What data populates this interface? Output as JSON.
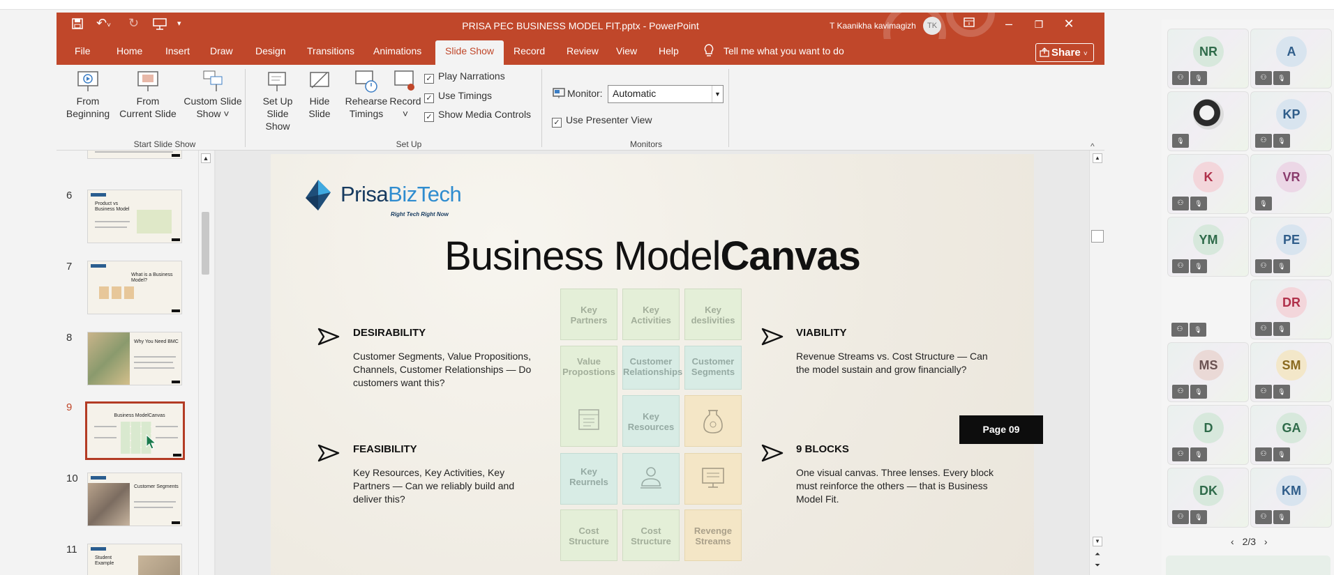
{
  "window": {
    "doc_title": "PRISA PEC BUSINESS MODEL FIT.pptx  -  PowerPoint",
    "user_name": "T Kaanikha kavimagizh",
    "user_initials": "TK",
    "accent": "#c0472a"
  },
  "tabs": [
    "File",
    "Home",
    "Insert",
    "Draw",
    "Design",
    "Transitions",
    "Animations",
    "Slide Show",
    "Record",
    "Review",
    "View",
    "Help"
  ],
  "active_tab": "Slide Show",
  "tell_me": "Tell me what you want to do",
  "share_label": "Share",
  "ribbon": {
    "from_beginning": [
      "From",
      "Beginning"
    ],
    "from_current": [
      "From",
      "Current Slide"
    ],
    "custom_show": [
      "Custom Slide",
      "Show ˅"
    ],
    "group_start": "Start Slide Show",
    "setup_show": [
      "Set Up",
      "Slide Show"
    ],
    "hide_slide": [
      "Hide",
      "Slide"
    ],
    "rehearse": [
      "Rehearse",
      "Timings"
    ],
    "record": [
      "Record",
      "˅"
    ],
    "play_narrations": "Play Narrations",
    "use_timings": "Use Timings",
    "show_media_controls": "Show Media Controls",
    "group_setup": "Set Up",
    "monitor_label": "Monitor:",
    "monitor_value": "Automatic",
    "use_presenter_view": "Use Presenter View",
    "group_monitors": "Monitors"
  },
  "thumbnails": [
    {
      "num": "6",
      "title": "Product vs Business Model"
    },
    {
      "num": "7",
      "title": "What is a Business Model?"
    },
    {
      "num": "8",
      "title": "Why You Need BMC"
    },
    {
      "num": "9",
      "title": "Business ModelCanvas",
      "selected": true
    },
    {
      "num": "10",
      "title": "Customer Segments"
    },
    {
      "num": "11",
      "title": "Student Example"
    }
  ],
  "slide": {
    "logo_a": "Prisa",
    "logo_b": "BizTech",
    "logo_tag": "Right Tech Right Now",
    "title_regular": "Business Model",
    "title_bold": "Canvas",
    "desirability": {
      "head": "DESIRABILITY",
      "body": "Customer Segments, Value Propositions, Channels, Customer Relationships — Do customers want this?"
    },
    "feasibility": {
      "head": "FEASIBILITY",
      "body": "Key Resources, Key Activities, Key Partners — Can we reliably build and deliver this?"
    },
    "viability": {
      "head": "VIABILITY",
      "body": "Revenue Streams vs. Cost Structure — Can the model sustain and grow financially?"
    },
    "nine_blocks": {
      "head": "9 BLOCKS",
      "body": "One visual canvas. Three lenses. Every block must reinforce the others — that is Business Model Fit."
    },
    "cells": {
      "key_partners": "Key Partners",
      "key_activities": "Key Activities",
      "key_deslivities": "Key deslivities",
      "value_propostions": "Value Propostions",
      "customer_relationships": "Customer Relationships",
      "customer_segments": "Customer Segments",
      "key_resources": "Key Resources",
      "key_reurnels": "Key Reurnels",
      "cost_structure_1": "Cost Structure",
      "cost_structure_2": "Cost Structure",
      "revenge_streams": "Revenge Streams"
    },
    "page_tag": "Page 09"
  },
  "participants": [
    {
      "initials": "NR",
      "color": "#2f6b4a",
      "bg": "#d7e8dc"
    },
    {
      "initials": "A",
      "color": "#2f5d8a",
      "bg": "#d8e4ef"
    },
    {
      "initials": "",
      "photo": true
    },
    {
      "initials": "KP",
      "color": "#2f5d8a",
      "bg": "#d8e4ef"
    },
    {
      "initials": "K",
      "color": "#b0304a",
      "bg": "#f3d6db"
    },
    {
      "initials": "VR",
      "color": "#8a3c6d",
      "bg": "#ecd7e6"
    },
    {
      "initials": "YM",
      "color": "#2f6b4a",
      "bg": "#d7e8dc"
    },
    {
      "initials": "PE",
      "color": "#2f5d8a",
      "bg": "#d8e4ef"
    },
    {
      "initials": "",
      "empty": true
    },
    {
      "initials": "DR",
      "color": "#b0304a",
      "bg": "#f3d6db"
    },
    {
      "initials": "MS",
      "color": "#6b5252",
      "bg": "#ead9d6"
    },
    {
      "initials": "SM",
      "color": "#8a6a1f",
      "bg": "#f3e7c9"
    },
    {
      "initials": "D",
      "color": "#2f6b4a",
      "bg": "#d7e8dc"
    },
    {
      "initials": "GA",
      "color": "#2f6b4a",
      "bg": "#d7e8dc"
    },
    {
      "initials": "DK",
      "color": "#2f6b4a",
      "bg": "#d7e8dc"
    },
    {
      "initials": "KM",
      "color": "#2f5d8a",
      "bg": "#d8e4ef"
    }
  ],
  "pager": "2/3"
}
